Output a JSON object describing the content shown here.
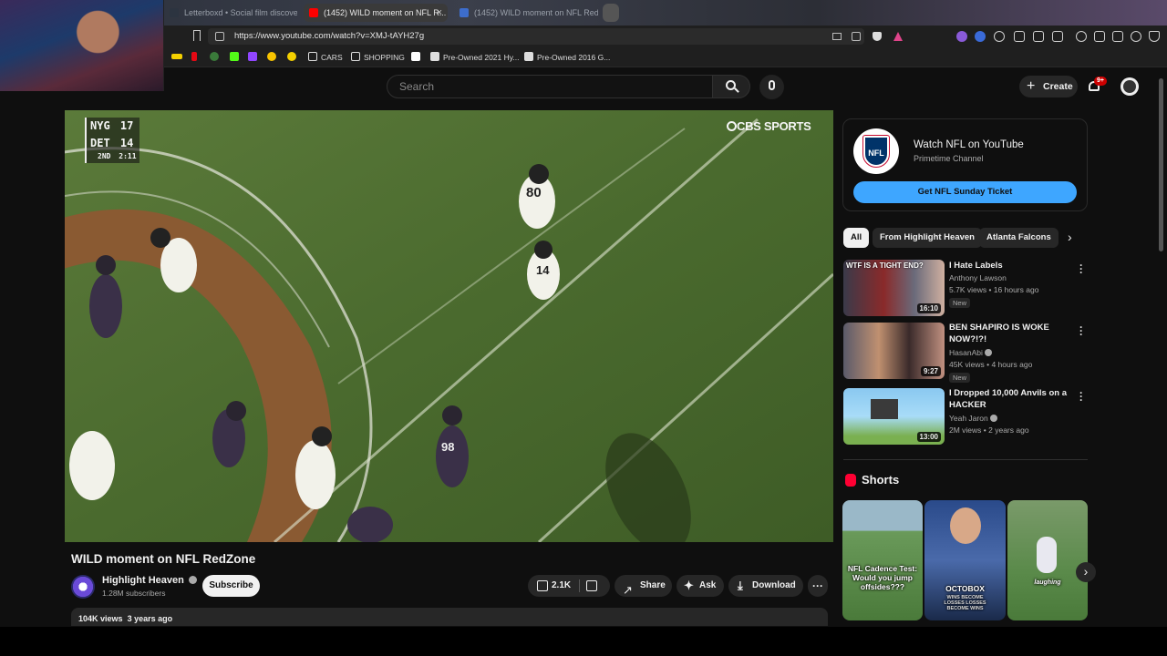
{
  "browser": {
    "tabs": [
      {
        "label": "Letterboxd • Social film discovery."
      },
      {
        "label": "(1452) WILD moment on NFL R..."
      },
      {
        "label": "(1452) WILD moment on NFL RedZ..."
      }
    ],
    "url": "https://www.youtube.com/watch?v=XMJ-tAYH27g",
    "bookmarks": [
      "CARS",
      "SHOPPING",
      "Pre-Owned 2021 Hy...",
      "Pre-Owned 2016 G..."
    ]
  },
  "header": {
    "search_placeholder": "Search",
    "create_label": "Create",
    "notif_badge": "9+"
  },
  "video": {
    "scorebug": {
      "team1": "NYG",
      "score1": "17",
      "team2": "DET",
      "score2": "14",
      "quarter": "2ND",
      "clock": "2:11"
    },
    "network": "CBS SPORTS",
    "jersey_numbers": [
      "80",
      "14",
      "98"
    ],
    "title": "WILD moment on NFL RedZone",
    "channel": "Highlight Heaven",
    "subscribers": "1.28M subscribers",
    "subscribe_label": "Subscribe",
    "likes": "2.1K",
    "share_label": "Share",
    "ask_label": "Ask",
    "download_label": "Download",
    "views": "104K views",
    "age": "3 years ago"
  },
  "ad": {
    "logo_text": "NFL",
    "title": "Watch NFL on YouTube",
    "subtitle": "Primetime Channel",
    "cta": "Get NFL Sunday Ticket"
  },
  "chips": [
    "All",
    "From Highlight Heaven",
    "Atlanta Falcons"
  ],
  "recommendations": [
    {
      "title": "I Hate Labels",
      "channel": "Anthony Lawson",
      "meta": "5.7K views • 16 hours ago",
      "badge": "New",
      "duration": "16:10",
      "thumb_text": "WTF IS A TIGHT END?"
    },
    {
      "title": "BEN SHAPIRO IS WOKE NOW?!?!",
      "channel": "HasanAbi",
      "meta": "45K views • 4 hours ago",
      "badge": "New",
      "duration": "9:27"
    },
    {
      "title": "I Dropped 10,000 Anvils on a HACKER",
      "channel": "Yeah Jaron",
      "meta": "2M views • 2 years ago",
      "duration": "13:00"
    }
  ],
  "shorts": {
    "heading": "Shorts",
    "items": [
      {
        "caption": "NFL Cadence Test: Would you jump offsides???"
      },
      {
        "caption": "OCTOBOX",
        "subcaption": "WINS BECOME LOSSES LOSSES BECOME WINS"
      },
      {
        "caption": "laughing"
      }
    ]
  }
}
